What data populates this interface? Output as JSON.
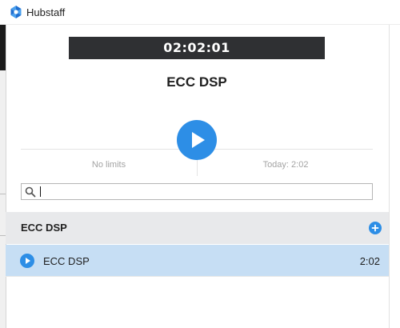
{
  "app": {
    "title": "Hubstaff",
    "logo_icon": "hubstaff-logo-icon"
  },
  "timer": {
    "elapsed": "02:02:01"
  },
  "current_project": {
    "name": "ECC DSP"
  },
  "controls": {
    "play_icon": "play-icon"
  },
  "limits": {
    "left_text": "No limits",
    "right_text": "Today: 2:02"
  },
  "search": {
    "value": "",
    "placeholder": "",
    "icon": "search-icon"
  },
  "groups": [
    {
      "name": "ECC DSP",
      "add_icon": "plus-icon",
      "projects": [
        {
          "name": "ECC DSP",
          "time": "2:02"
        }
      ]
    }
  ],
  "colors": {
    "accent": "#2d8ee6",
    "timer_bg": "#2f3033",
    "selected_row": "#c6def4",
    "group_header": "#e8e9eb"
  }
}
